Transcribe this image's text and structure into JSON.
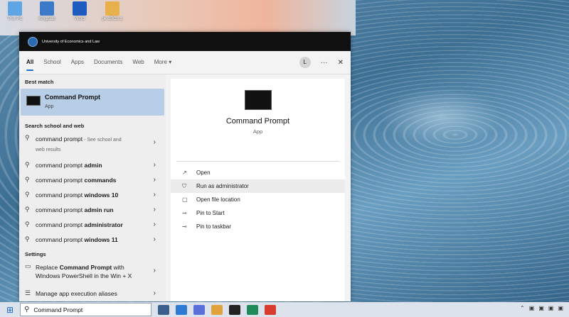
{
  "desktop_icons": [
    {
      "label": "This PC",
      "color": "#5ea6e6"
    },
    {
      "label": "Kingbato",
      "color": "#3b79c9"
    },
    {
      "label": "Word",
      "color": "#1d5bbf"
    },
    {
      "label": "pk-1BCS.1",
      "color": "#e8b04a"
    }
  ],
  "org": {
    "name": "University of Economics and Law"
  },
  "tabs": [
    "All",
    "School",
    "Apps",
    "Documents",
    "Web",
    "More"
  ],
  "more_caret": "▾",
  "header_icons": {
    "avatar": "L",
    "more": "···",
    "close": "✕"
  },
  "best_match": {
    "heading": "Best match",
    "name": "Command Prompt",
    "subtitle": "App"
  },
  "web_section": {
    "heading": "Search school and web",
    "first": {
      "query": "command prompt",
      "suffix": " - See school and",
      "suffix2": "web results"
    },
    "items": [
      {
        "prefix": "command prompt ",
        "bold": "admin"
      },
      {
        "prefix": "command prompt ",
        "bold": "commands"
      },
      {
        "prefix": "command prompt ",
        "bold": "windows 10"
      },
      {
        "prefix": "command prompt ",
        "bold": "admin run"
      },
      {
        "prefix": "command prompt ",
        "bold": "administrator"
      },
      {
        "prefix": "command prompt ",
        "bold": "windows 11"
      }
    ]
  },
  "settings": {
    "heading": "Settings",
    "replace": {
      "a": "Replace ",
      "b": "Command Prompt",
      "c": " with",
      "line2": "Windows PowerShell in the Win + X"
    },
    "manage": "Manage app execution aliases"
  },
  "detail": {
    "name": "Command Prompt",
    "subtitle": "App",
    "actions": [
      "Open",
      "Run as administrator",
      "Open file location",
      "Pin to Start",
      "Pin to taskbar"
    ]
  },
  "taskbar": {
    "search_value": "Command Prompt",
    "icons": [
      "#3b5f8a",
      "#2e7bd6",
      "#5a6fd8",
      "#e2a23b",
      "#222222",
      "#1f8a5a",
      "#d63b2e"
    ]
  }
}
